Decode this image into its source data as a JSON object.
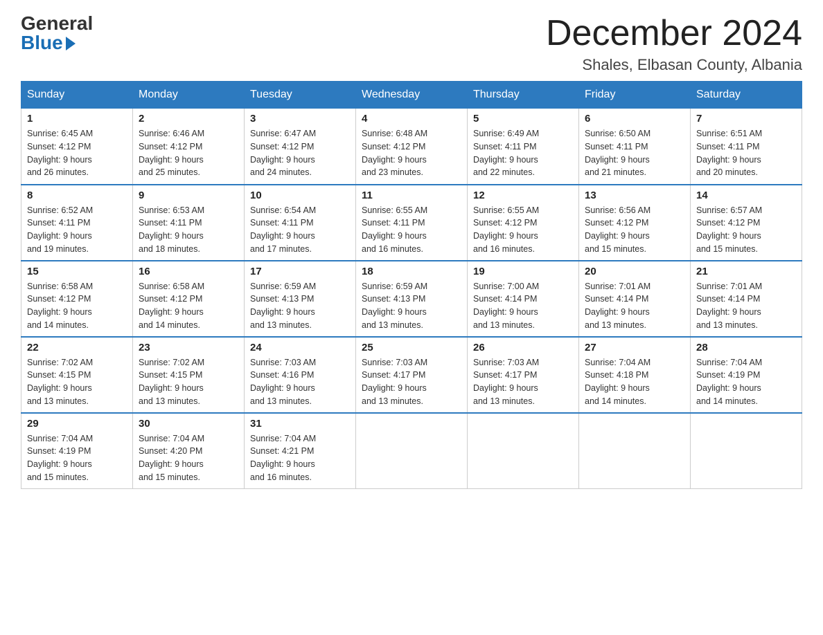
{
  "header": {
    "logo_general": "General",
    "logo_blue": "Blue",
    "month_title": "December 2024",
    "location": "Shales, Elbasan County, Albania"
  },
  "weekdays": [
    "Sunday",
    "Monday",
    "Tuesday",
    "Wednesday",
    "Thursday",
    "Friday",
    "Saturday"
  ],
  "weeks": [
    [
      {
        "day": "1",
        "sunrise": "6:45 AM",
        "sunset": "4:12 PM",
        "daylight": "9 hours and 26 minutes."
      },
      {
        "day": "2",
        "sunrise": "6:46 AM",
        "sunset": "4:12 PM",
        "daylight": "9 hours and 25 minutes."
      },
      {
        "day": "3",
        "sunrise": "6:47 AM",
        "sunset": "4:12 PM",
        "daylight": "9 hours and 24 minutes."
      },
      {
        "day": "4",
        "sunrise": "6:48 AM",
        "sunset": "4:12 PM",
        "daylight": "9 hours and 23 minutes."
      },
      {
        "day": "5",
        "sunrise": "6:49 AM",
        "sunset": "4:11 PM",
        "daylight": "9 hours and 22 minutes."
      },
      {
        "day": "6",
        "sunrise": "6:50 AM",
        "sunset": "4:11 PM",
        "daylight": "9 hours and 21 minutes."
      },
      {
        "day": "7",
        "sunrise": "6:51 AM",
        "sunset": "4:11 PM",
        "daylight": "9 hours and 20 minutes."
      }
    ],
    [
      {
        "day": "8",
        "sunrise": "6:52 AM",
        "sunset": "4:11 PM",
        "daylight": "9 hours and 19 minutes."
      },
      {
        "day": "9",
        "sunrise": "6:53 AM",
        "sunset": "4:11 PM",
        "daylight": "9 hours and 18 minutes."
      },
      {
        "day": "10",
        "sunrise": "6:54 AM",
        "sunset": "4:11 PM",
        "daylight": "9 hours and 17 minutes."
      },
      {
        "day": "11",
        "sunrise": "6:55 AM",
        "sunset": "4:11 PM",
        "daylight": "9 hours and 16 minutes."
      },
      {
        "day": "12",
        "sunrise": "6:55 AM",
        "sunset": "4:12 PM",
        "daylight": "9 hours and 16 minutes."
      },
      {
        "day": "13",
        "sunrise": "6:56 AM",
        "sunset": "4:12 PM",
        "daylight": "9 hours and 15 minutes."
      },
      {
        "day": "14",
        "sunrise": "6:57 AM",
        "sunset": "4:12 PM",
        "daylight": "9 hours and 15 minutes."
      }
    ],
    [
      {
        "day": "15",
        "sunrise": "6:58 AM",
        "sunset": "4:12 PM",
        "daylight": "9 hours and 14 minutes."
      },
      {
        "day": "16",
        "sunrise": "6:58 AM",
        "sunset": "4:12 PM",
        "daylight": "9 hours and 14 minutes."
      },
      {
        "day": "17",
        "sunrise": "6:59 AM",
        "sunset": "4:13 PM",
        "daylight": "9 hours and 13 minutes."
      },
      {
        "day": "18",
        "sunrise": "6:59 AM",
        "sunset": "4:13 PM",
        "daylight": "9 hours and 13 minutes."
      },
      {
        "day": "19",
        "sunrise": "7:00 AM",
        "sunset": "4:14 PM",
        "daylight": "9 hours and 13 minutes."
      },
      {
        "day": "20",
        "sunrise": "7:01 AM",
        "sunset": "4:14 PM",
        "daylight": "9 hours and 13 minutes."
      },
      {
        "day": "21",
        "sunrise": "7:01 AM",
        "sunset": "4:14 PM",
        "daylight": "9 hours and 13 minutes."
      }
    ],
    [
      {
        "day": "22",
        "sunrise": "7:02 AM",
        "sunset": "4:15 PM",
        "daylight": "9 hours and 13 minutes."
      },
      {
        "day": "23",
        "sunrise": "7:02 AM",
        "sunset": "4:15 PM",
        "daylight": "9 hours and 13 minutes."
      },
      {
        "day": "24",
        "sunrise": "7:03 AM",
        "sunset": "4:16 PM",
        "daylight": "9 hours and 13 minutes."
      },
      {
        "day": "25",
        "sunrise": "7:03 AM",
        "sunset": "4:17 PM",
        "daylight": "9 hours and 13 minutes."
      },
      {
        "day": "26",
        "sunrise": "7:03 AM",
        "sunset": "4:17 PM",
        "daylight": "9 hours and 13 minutes."
      },
      {
        "day": "27",
        "sunrise": "7:04 AM",
        "sunset": "4:18 PM",
        "daylight": "9 hours and 14 minutes."
      },
      {
        "day": "28",
        "sunrise": "7:04 AM",
        "sunset": "4:19 PM",
        "daylight": "9 hours and 14 minutes."
      }
    ],
    [
      {
        "day": "29",
        "sunrise": "7:04 AM",
        "sunset": "4:19 PM",
        "daylight": "9 hours and 15 minutes."
      },
      {
        "day": "30",
        "sunrise": "7:04 AM",
        "sunset": "4:20 PM",
        "daylight": "9 hours and 15 minutes."
      },
      {
        "day": "31",
        "sunrise": "7:04 AM",
        "sunset": "4:21 PM",
        "daylight": "9 hours and 16 minutes."
      },
      null,
      null,
      null,
      null
    ]
  ]
}
